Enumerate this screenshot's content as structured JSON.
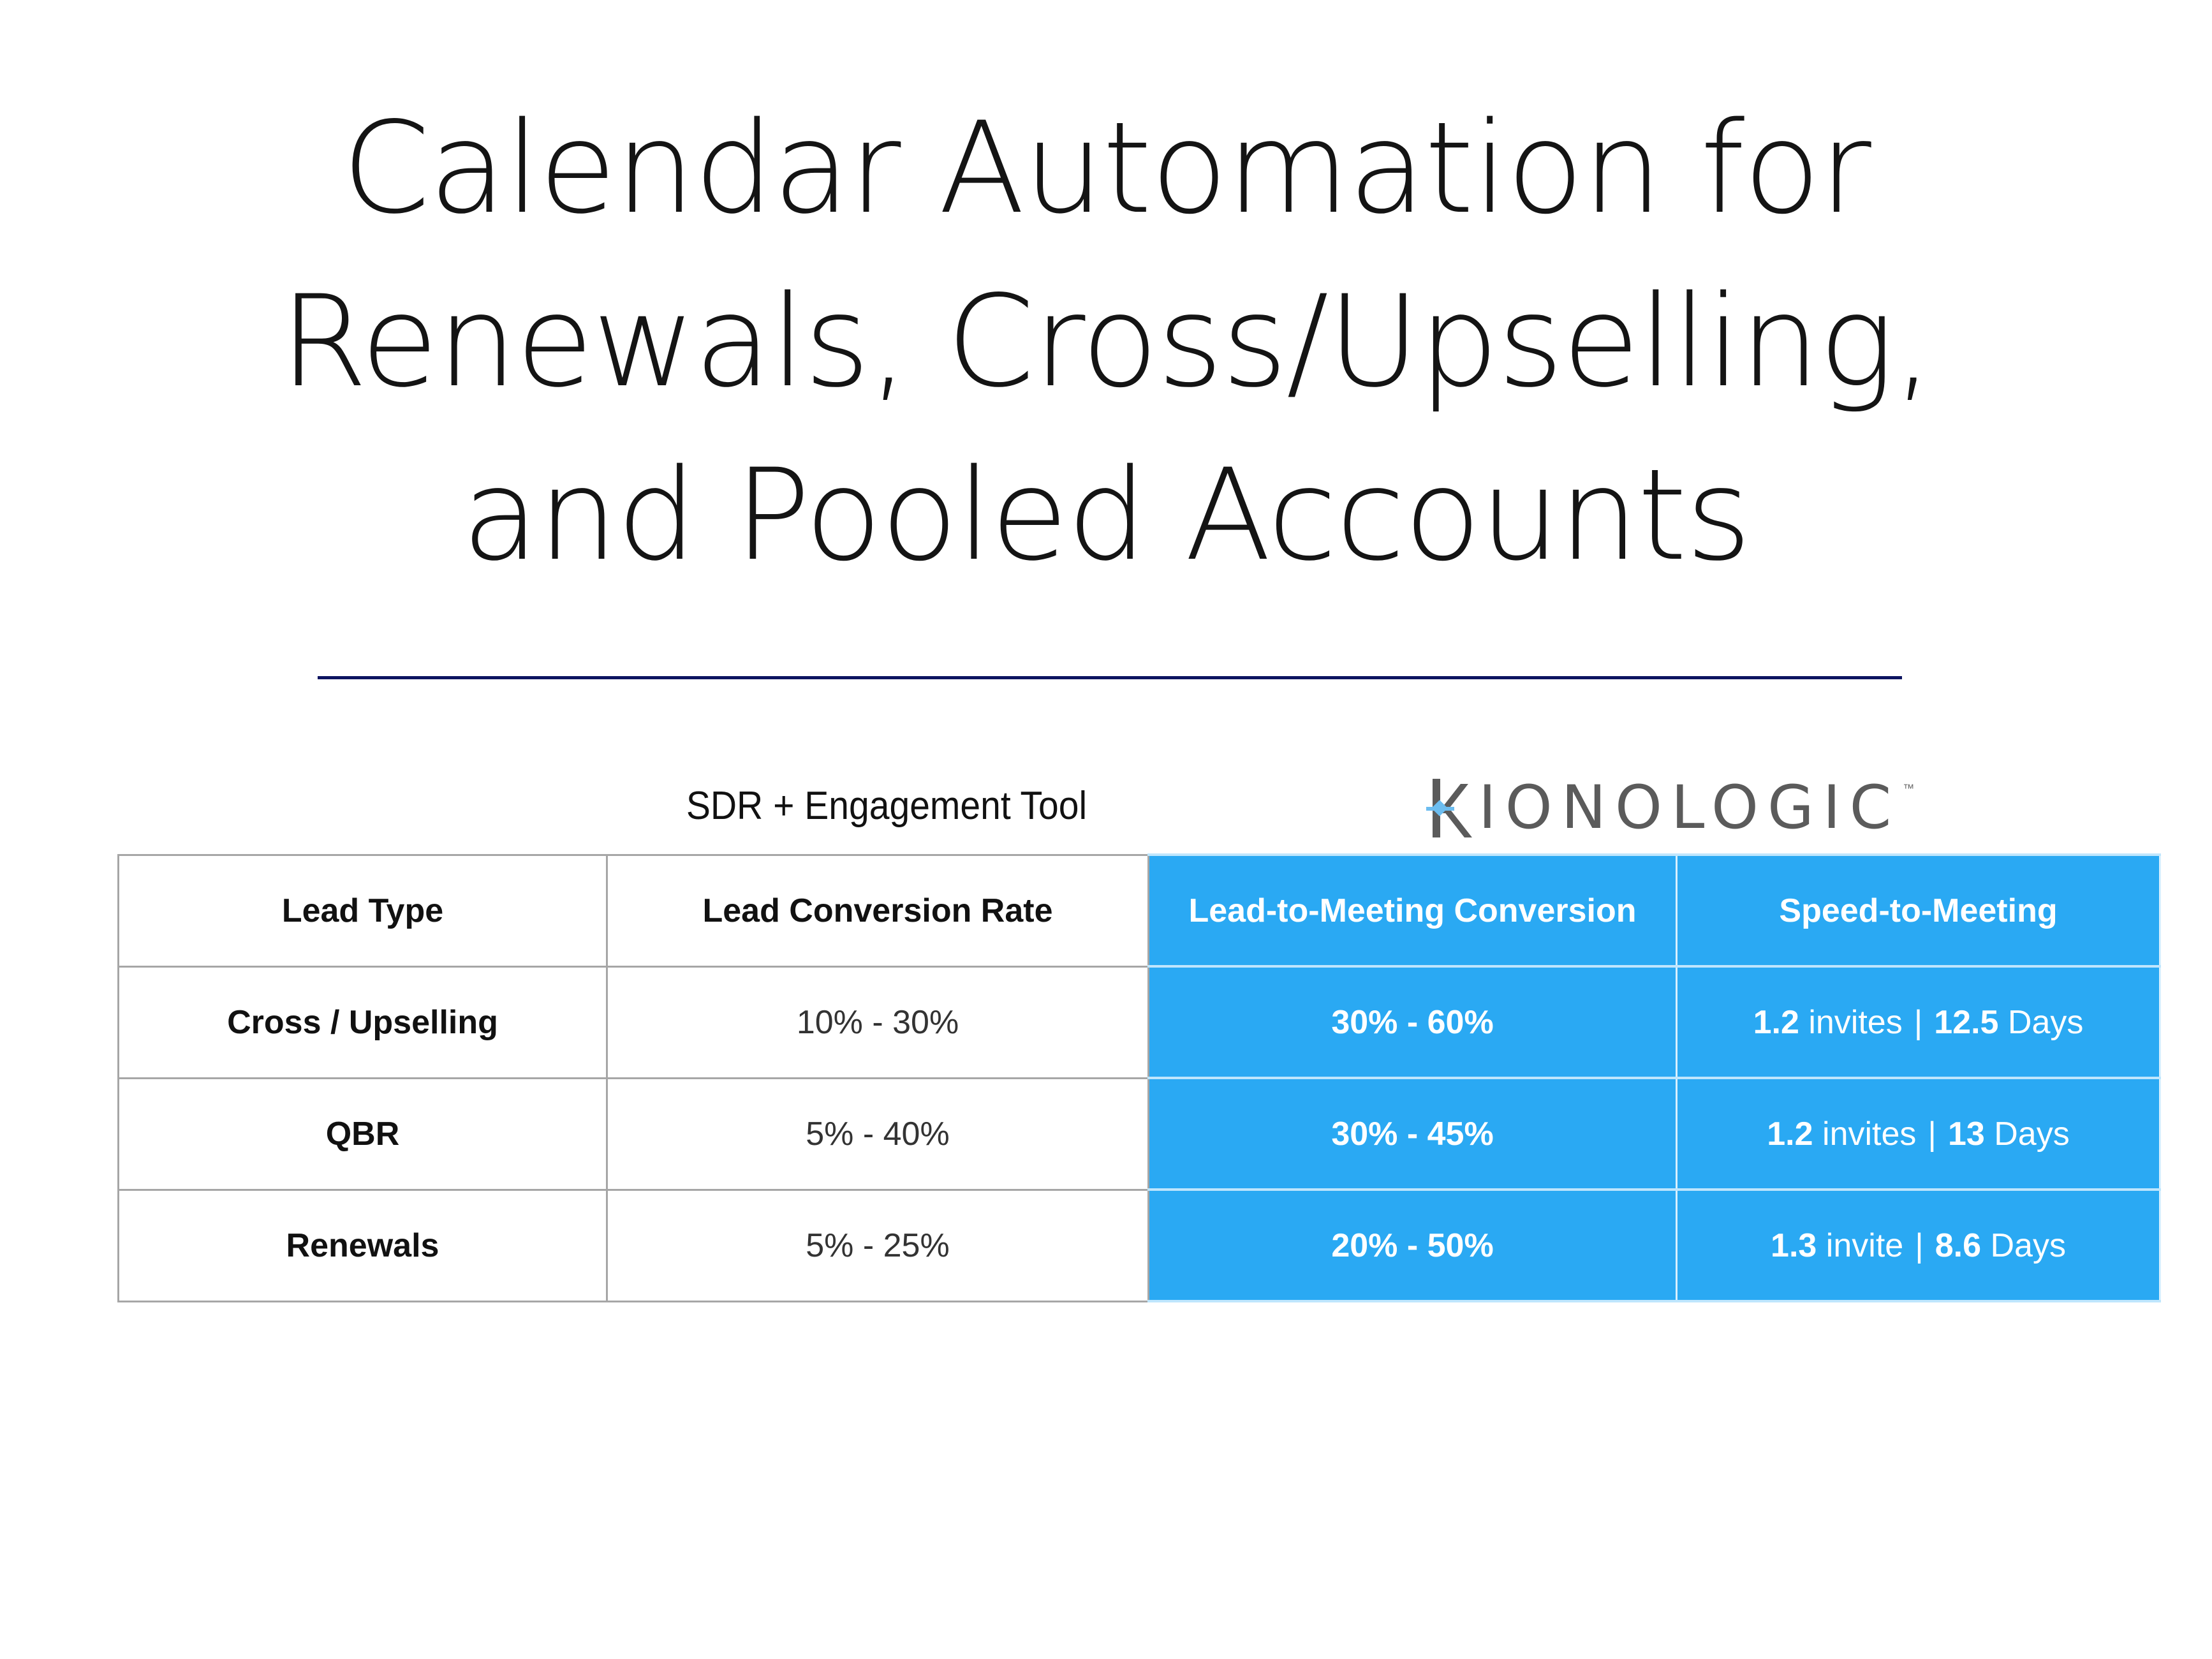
{
  "title": {
    "lines": [
      "Calendar Automation for",
      "Renewals, Cross/Upselling,",
      "and Pooled Accounts"
    ],
    "color": "#141414"
  },
  "divider": {
    "color": "#0d1461"
  },
  "comparison": {
    "left_label": "SDR + Engagement Tool",
    "right_brand": {
      "text": "KRONOLOGIC",
      "display": "IONOLOGIC",
      "trademark": "™",
      "icon": "kronologic-k-logo-icon"
    },
    "accent_color": "#2aa9f3"
  },
  "table": {
    "headers": [
      "Lead Type",
      "Lead Conversion Rate",
      "Lead-to-Meeting Conversion",
      "Speed-to-Meeting"
    ],
    "rows": [
      {
        "lead_type": "Cross / Upselling",
        "lead_conversion_rate": "10% - 30%",
        "lead_to_meeting": "30% - 60%",
        "speed": {
          "invites": "1.2",
          "invites_unit": "invites",
          "days": "12.5",
          "days_unit": "Days",
          "separator": "|"
        }
      },
      {
        "lead_type": "QBR",
        "lead_conversion_rate": "5% - 40%",
        "lead_to_meeting": "30% - 45%",
        "speed": {
          "invites": "1.2",
          "invites_unit": "invites",
          "days": "13",
          "days_unit": "Days",
          "separator": "|"
        }
      },
      {
        "lead_type": "Renewals",
        "lead_conversion_rate": "5% - 25%",
        "lead_to_meeting": "20% - 50%",
        "speed": {
          "invites": "1.3",
          "invites_unit": "invite",
          "days": "8.6",
          "days_unit": "Days",
          "separator": "|"
        }
      }
    ]
  }
}
